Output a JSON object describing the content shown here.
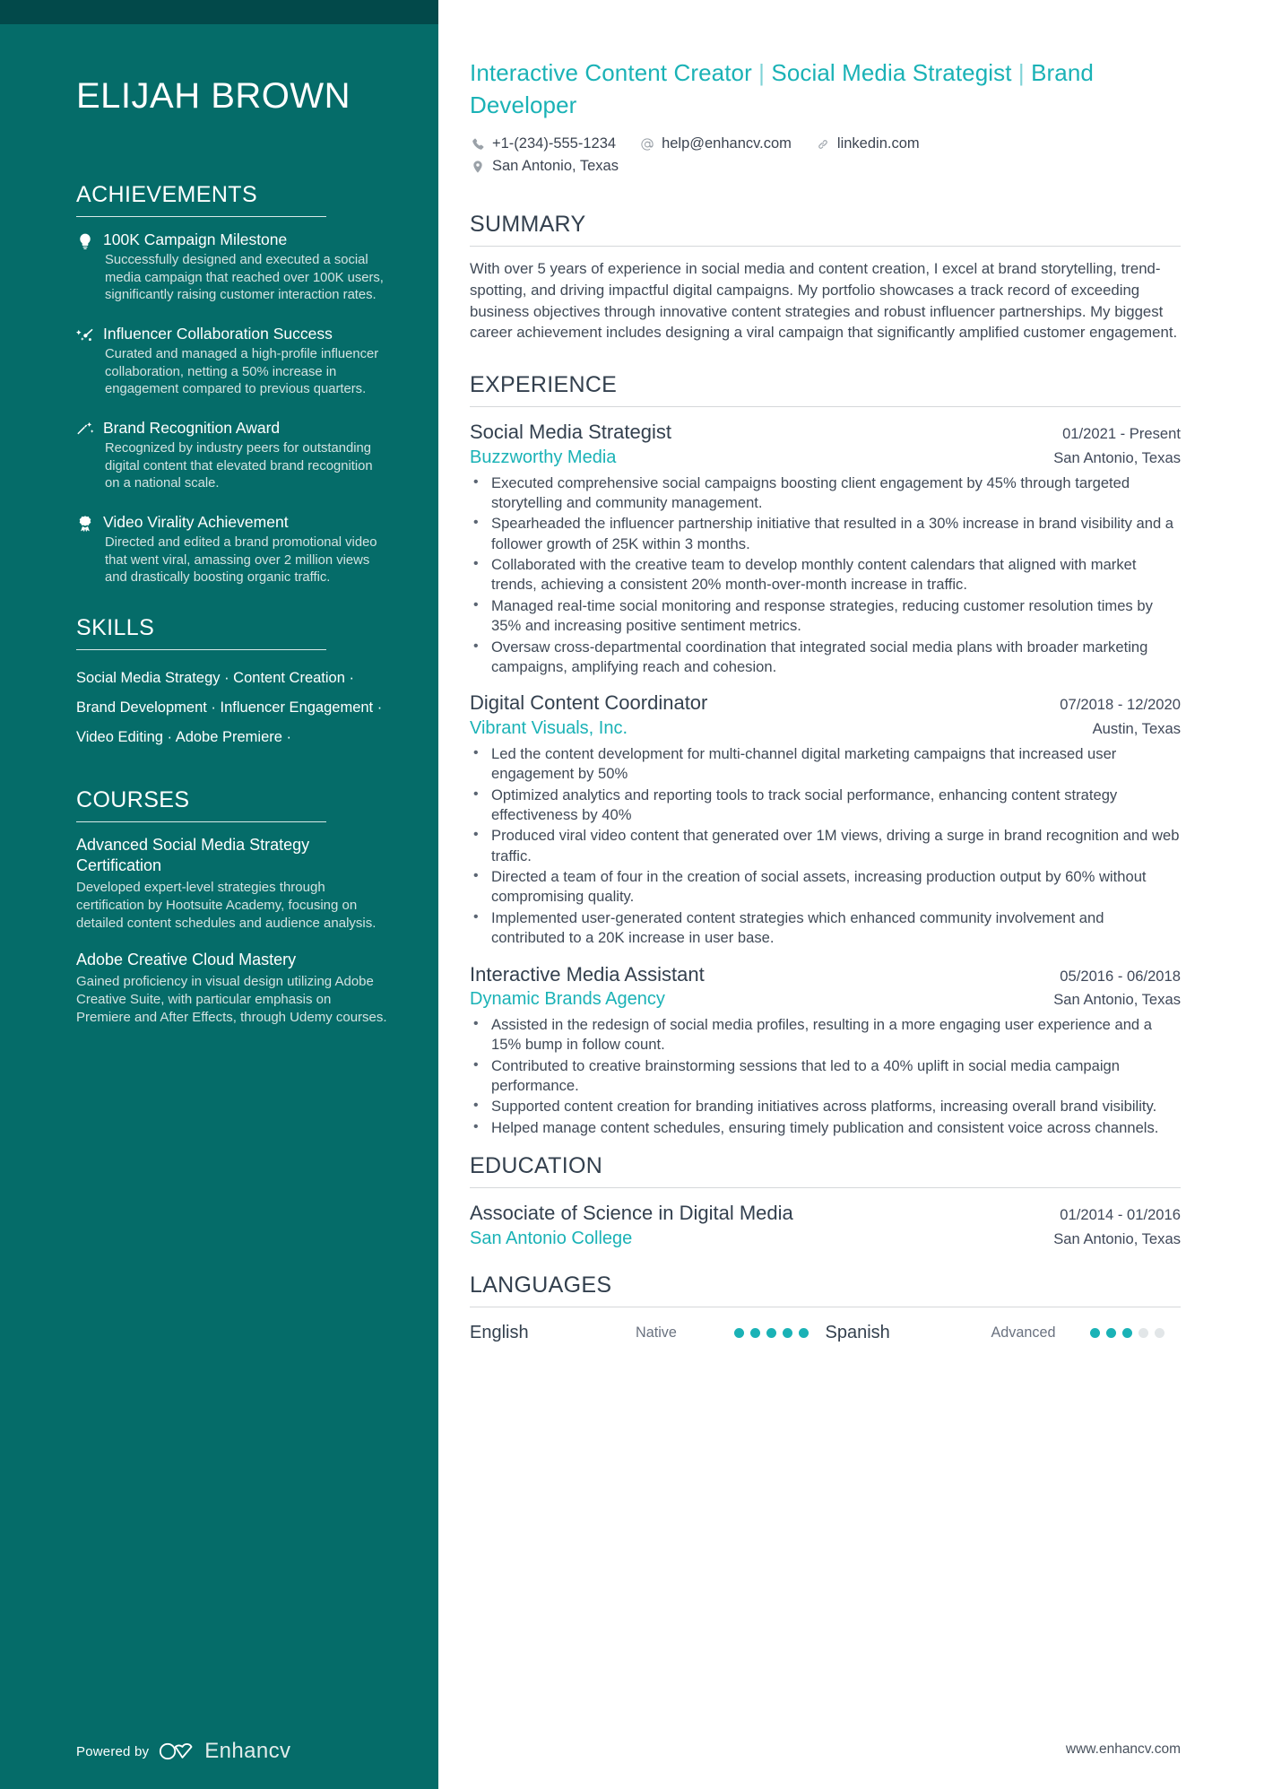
{
  "sidebar": {
    "name": "ELIJAH BROWN",
    "achievements": {
      "title": "ACHIEVEMENTS",
      "items": [
        {
          "icon": "lightbulb-icon",
          "title": "100K Campaign Milestone",
          "description": "Successfully designed and executed a social media campaign that reached over 100K users, significantly raising customer interaction rates."
        },
        {
          "icon": "shooting-star-icon",
          "title": "Influencer Collaboration Success",
          "description": "Curated and managed a high-profile influencer collaboration, netting a 50% increase in engagement compared to previous quarters."
        },
        {
          "icon": "magic-wand-icon",
          "title": "Brand Recognition Award",
          "description": "Recognized by industry peers for outstanding digital content that elevated brand recognition on a national scale."
        },
        {
          "icon": "award-medal-icon",
          "title": "Video Virality Achievement",
          "description": "Directed and edited a brand promotional video that went viral, amassing over 2 million views and drastically boosting organic traffic."
        }
      ]
    },
    "skills": {
      "title": "SKILLS",
      "items": [
        "Social Media Strategy",
        "Content Creation",
        "Brand Development",
        "Influencer Engagement",
        "Video Editing",
        "Adobe Premiere"
      ],
      "separator": "·"
    },
    "courses": {
      "title": "COURSES",
      "items": [
        {
          "title": "Advanced Social Media Strategy Certification",
          "description": "Developed expert-level strategies through certification by Hootsuite Academy, focusing on detailed content schedules and audience analysis."
        },
        {
          "title": "Adobe Creative Cloud Mastery",
          "description": "Gained proficiency in visual design utilizing Adobe Creative Suite, with particular emphasis on Premiere and After Effects, through Udemy courses."
        }
      ]
    },
    "footer": {
      "powered_by": "Powered by",
      "brand": "Enhancv"
    }
  },
  "main": {
    "headline": {
      "part1": "Interactive Content Creator",
      "sep1": " | ",
      "part2": "Social Media Strategist",
      "sep2": " | ",
      "part3": "Brand Developer"
    },
    "contact": {
      "phone": "+1-(234)-555-1234",
      "email": "help@enhancv.com",
      "linkedin": "linkedin.com",
      "location": "San Antonio, Texas"
    },
    "summary": {
      "title": "SUMMARY",
      "text": "With over 5 years of experience in social media and content creation, I excel at brand storytelling, trend-spotting, and driving impactful digital campaigns. My portfolio showcases a track record of exceeding business objectives through innovative content strategies and robust influencer partnerships. My biggest career achievement includes designing a viral campaign that significantly amplified customer engagement."
    },
    "experience": {
      "title": "EXPERIENCE",
      "jobs": [
        {
          "title": "Social Media Strategist",
          "dates": "01/2021 - Present",
          "company": "Buzzworthy Media",
          "location": "San Antonio, Texas",
          "bullets": [
            "Executed comprehensive social campaigns boosting client engagement by 45% through targeted storytelling and community management.",
            "Spearheaded the influencer partnership initiative that resulted in a 30% increase in brand visibility and a follower growth of 25K within 3 months.",
            "Collaborated with the creative team to develop monthly content calendars that aligned with market trends, achieving a consistent 20% month-over-month increase in traffic.",
            "Managed real-time social monitoring and response strategies, reducing customer resolution times by 35% and increasing positive sentiment metrics.",
            "Oversaw cross-departmental coordination that integrated social media plans with broader marketing campaigns, amplifying reach and cohesion."
          ]
        },
        {
          "title": "Digital Content Coordinator",
          "dates": "07/2018 - 12/2020",
          "company": "Vibrant Visuals, Inc.",
          "location": "Austin, Texas",
          "bullets": [
            "Led the content development for multi-channel digital marketing campaigns that increased user engagement by 50%",
            "Optimized analytics and reporting tools to track social performance, enhancing content strategy effectiveness by 40%",
            "Produced viral video content that generated over 1M views, driving a surge in brand recognition and web traffic.",
            "Directed a team of four in the creation of social assets, increasing production output by 60% without compromising quality.",
            "Implemented user-generated content strategies which enhanced community involvement and contributed to a 20K increase in user base."
          ]
        },
        {
          "title": "Interactive Media Assistant",
          "dates": "05/2016 - 06/2018",
          "company": "Dynamic Brands Agency",
          "location": "San Antonio, Texas",
          "bullets": [
            "Assisted in the redesign of social media profiles, resulting in a more engaging user experience and a 15% bump in follow count.",
            "Contributed to creative brainstorming sessions that led to a 40% uplift in social media campaign performance.",
            "Supported content creation for branding initiatives across platforms, increasing overall brand visibility.",
            "Helped manage content schedules, ensuring timely publication and consistent voice across channels."
          ]
        }
      ]
    },
    "education": {
      "title": "EDUCATION",
      "entries": [
        {
          "degree": "Associate of Science in Digital Media",
          "dates": "01/2014 - 01/2016",
          "school": "San Antonio College",
          "location": "San Antonio, Texas"
        }
      ]
    },
    "languages": {
      "title": "LANGUAGES",
      "items": [
        {
          "name": "English",
          "level": "Native",
          "filled": 5,
          "total": 5
        },
        {
          "name": "Spanish",
          "level": "Advanced",
          "filled": 3,
          "total": 5
        }
      ]
    },
    "footer_url": "www.enhancv.com"
  },
  "colors": {
    "sidebar_bg": "#056c69",
    "sidebar_topband": "#02494a",
    "accent_teal": "#1ab2b6",
    "heading_dark": "#33404e",
    "body_text": "#404a57"
  }
}
